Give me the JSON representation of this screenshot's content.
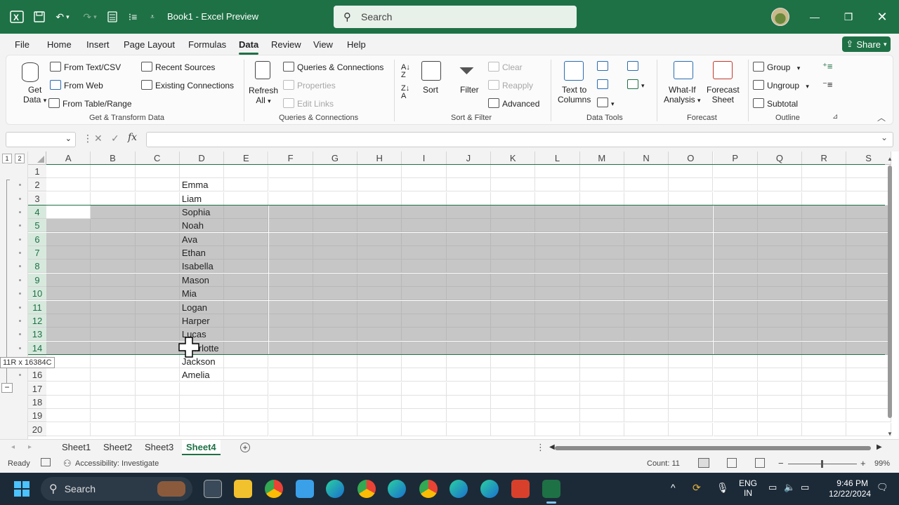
{
  "titlebar": {
    "doc_title": "Book1  -  Excel Preview",
    "search_placeholder": "Search"
  },
  "menu": {
    "tabs": [
      "File",
      "Home",
      "Insert",
      "Page Layout",
      "Formulas",
      "Data",
      "Review",
      "View",
      "Help"
    ],
    "active": "Data",
    "share": "Share"
  },
  "ribbon": {
    "get_transform": {
      "get_data": "Get",
      "get_data2": "Data",
      "from_text_csv": "From Text/CSV",
      "from_web": "From Web",
      "from_table_range": "From Table/Range",
      "recent_sources": "Recent Sources",
      "existing_connections": "Existing Connections",
      "label": "Get & Transform Data"
    },
    "queries": {
      "refresh_all": "Refresh",
      "refresh_all2": "All",
      "queries_connections": "Queries & Connections",
      "properties": "Properties",
      "edit_links": "Edit Links",
      "label": "Queries & Connections"
    },
    "sort_filter": {
      "sort": "Sort",
      "filter": "Filter",
      "clear": "Clear",
      "reapply": "Reapply",
      "advanced": "Advanced",
      "label": "Sort & Filter"
    },
    "data_tools": {
      "text_to_columns": "Text to",
      "text_to_columns2": "Columns",
      "label": "Data Tools"
    },
    "forecast": {
      "what_if": "What-If",
      "what_if2": "Analysis",
      "forecast_sheet": "Forecast",
      "forecast_sheet2": "Sheet",
      "label": "Forecast"
    },
    "outline": {
      "group": "Group",
      "ungroup": "Ungroup",
      "subtotal": "Subtotal",
      "label": "Outline"
    }
  },
  "grid": {
    "columns": [
      "A",
      "B",
      "C",
      "D",
      "E",
      "F",
      "G",
      "H",
      "I",
      "J",
      "K",
      "L",
      "M",
      "N",
      "O",
      "P",
      "Q",
      "R",
      "S"
    ],
    "rows": [
      "1",
      "2",
      "3",
      "4",
      "5",
      "6",
      "7",
      "8",
      "9",
      "10",
      "11",
      "12",
      "13",
      "14",
      "15",
      "16",
      "17",
      "18",
      "19",
      "20"
    ],
    "selected_rows": [
      "4",
      "5",
      "6",
      "7",
      "8",
      "9",
      "10",
      "11",
      "12",
      "13",
      "14"
    ],
    "column_d": {
      "2": "Emma",
      "3": "Liam",
      "4": "Sophia",
      "5": "Noah",
      "6": "Ava",
      "7": "Ethan",
      "8": "Isabella",
      "9": "Mason",
      "10": "Mia",
      "11": "Logan",
      "12": "Harper",
      "13": "Lucas",
      "14": "Charlotte",
      "15": "Jackson",
      "16": "Amelia"
    },
    "row14_visible_text": "lotte",
    "selection_tooltip": "11R x 16384C",
    "outline_levels": [
      "1",
      "2"
    ],
    "outline_collapse_button": "−"
  },
  "sheets": {
    "tabs": [
      "Sheet1",
      "Sheet2",
      "Sheet3",
      "Sheet4"
    ],
    "active": "Sheet4"
  },
  "status": {
    "ready": "Ready",
    "accessibility": "Accessibility: Investigate",
    "count": "Count: 11",
    "zoom": "99%",
    "zoom_minus": "−",
    "zoom_plus": "+"
  },
  "taskbar": {
    "search": "Search",
    "lang1": "ENG",
    "lang2": "IN",
    "time": "9:46 PM",
    "date": "12/22/2024"
  },
  "colors": {
    "excel_green": "#1e7145",
    "selection_gray": "#c6c6c6",
    "taskbar": "#1c2a38"
  }
}
